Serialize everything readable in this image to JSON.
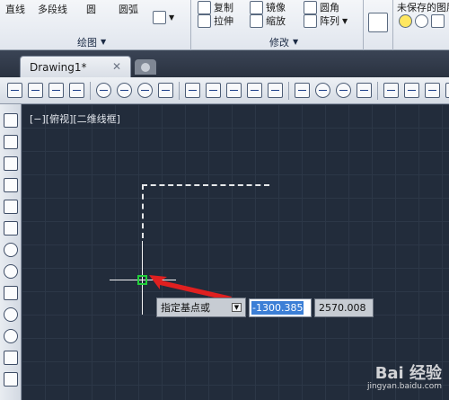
{
  "ribbon": {
    "draw": {
      "line_label": "直线",
      "polyline_label": "多段线",
      "circle_label": "圆",
      "arc_label": "圆弧",
      "panel_title": "绘图"
    },
    "modify": {
      "copy_label": "复制",
      "mirror_label": "镜像",
      "fillet_label": "圆角",
      "stretch_label": "拉伸",
      "scale_label": "缩放",
      "array_label": "阵列",
      "panel_title": "修改"
    },
    "right_label": "未保存的图层状态"
  },
  "tabs": {
    "active": "Drawing1*",
    "close_glyph": "✕"
  },
  "viewport": {
    "label": "[−][俯视][二维线框]"
  },
  "command": {
    "prompt": "指定基点或",
    "x_value": "-1300.385",
    "y_value": "2570.008",
    "dropdown_glyph": "▼"
  },
  "watermark": {
    "brand": "Bai 经验",
    "url": "jingyan.baidu.com"
  },
  "colors": {
    "canvas": "#222c3b",
    "grid": "#2c3747",
    "pickbox": "#22d13a",
    "arrow": "#e02020",
    "highlight": "#3c7fd6"
  }
}
